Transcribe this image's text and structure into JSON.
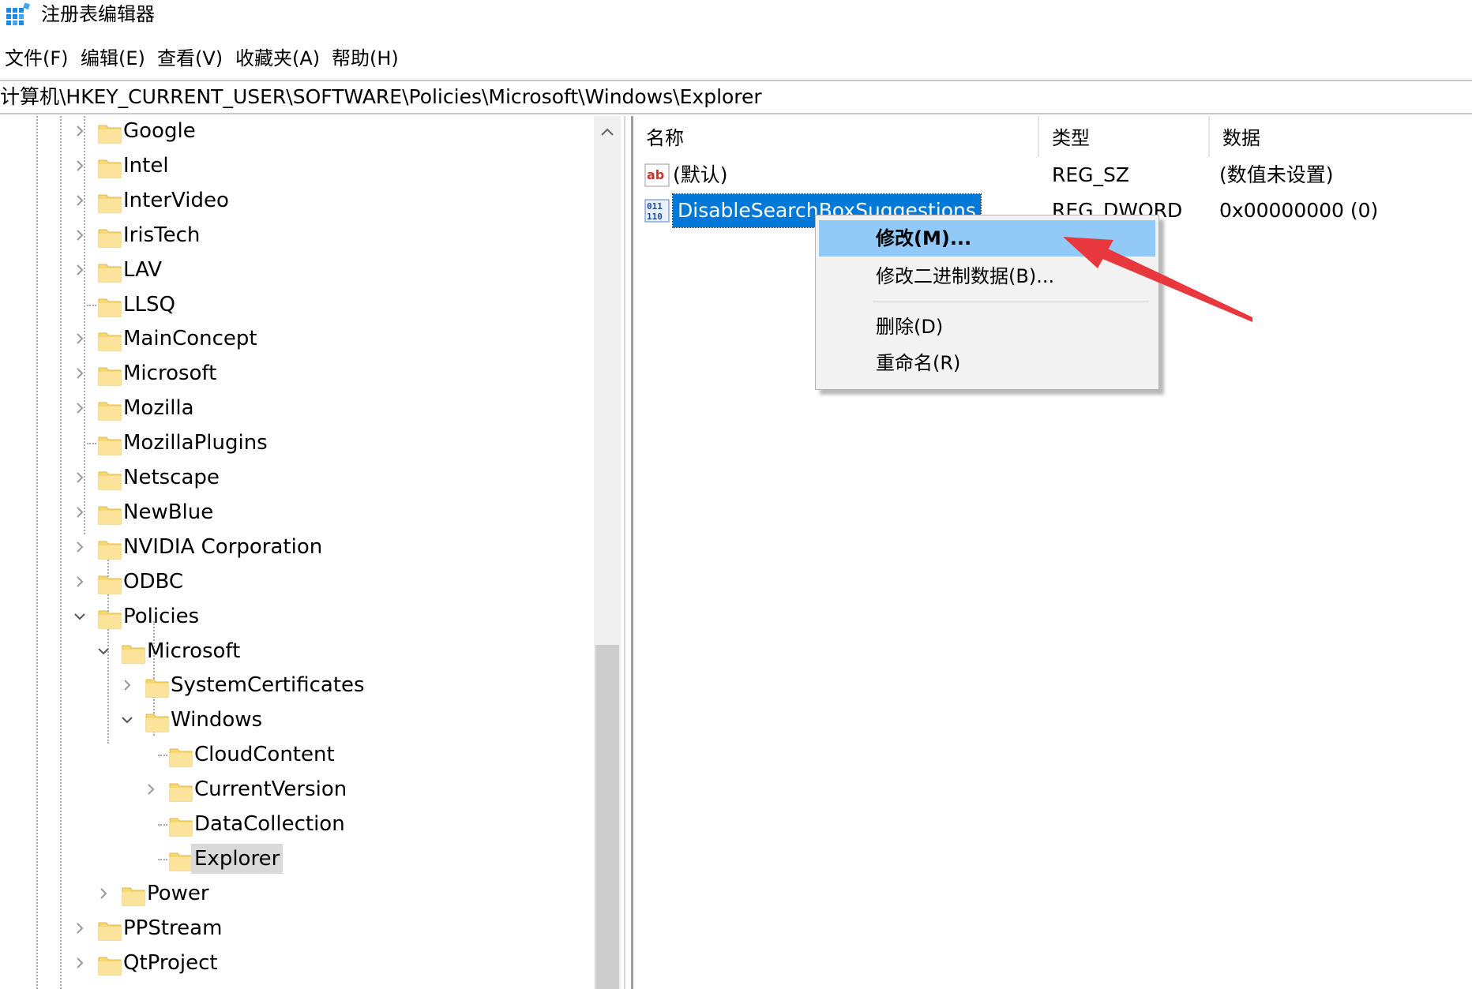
{
  "window": {
    "title": "注册表编辑器"
  },
  "menu": [
    {
      "label": "文件(F)"
    },
    {
      "label": "编辑(E)"
    },
    {
      "label": "查看(V)"
    },
    {
      "label": "收藏夹(A)"
    },
    {
      "label": "帮助(H)"
    }
  ],
  "address": {
    "path": "计算机\\HKEY_CURRENT_USER\\SOFTWARE\\Policies\\Microsoft\\Windows\\Explorer"
  },
  "tree": {
    "items": [
      {
        "label": "Google",
        "expander": "collapsed"
      },
      {
        "label": "Intel",
        "expander": "collapsed"
      },
      {
        "label": "InterVideo",
        "expander": "collapsed"
      },
      {
        "label": "IrisTech",
        "expander": "collapsed"
      },
      {
        "label": "LAV",
        "expander": "collapsed"
      },
      {
        "label": "LLSQ",
        "expander": "none"
      },
      {
        "label": "MainConcept",
        "expander": "collapsed"
      },
      {
        "label": "Microsoft",
        "expander": "collapsed"
      },
      {
        "label": "Mozilla",
        "expander": "collapsed"
      },
      {
        "label": "MozillaPlugins",
        "expander": "none"
      },
      {
        "label": "Netscape",
        "expander": "collapsed"
      },
      {
        "label": "NewBlue",
        "expander": "collapsed"
      },
      {
        "label": "NVIDIA Corporation",
        "expander": "collapsed"
      },
      {
        "label": "ODBC",
        "expander": "collapsed"
      },
      {
        "label": "Policies",
        "expander": "expanded"
      },
      {
        "label": "Microsoft",
        "expander": "expanded"
      },
      {
        "label": "SystemCertificates",
        "expander": "collapsed"
      },
      {
        "label": "Windows",
        "expander": "expanded"
      },
      {
        "label": "CloudContent",
        "expander": "none"
      },
      {
        "label": "CurrentVersion",
        "expander": "collapsed"
      },
      {
        "label": "DataCollection",
        "expander": "none"
      },
      {
        "label": "Explorer",
        "expander": "none",
        "selected": true
      },
      {
        "label": "Power",
        "expander": "collapsed"
      },
      {
        "label": "PPStream",
        "expander": "collapsed"
      },
      {
        "label": "QtProject",
        "expander": "collapsed"
      }
    ]
  },
  "list": {
    "columns": {
      "name": "名称",
      "type": "类型",
      "data": "数据"
    },
    "rows": [
      {
        "name": "(默认)",
        "type": "REG_SZ",
        "data": "(数值未设置)",
        "icon": "string-value-icon"
      },
      {
        "name": "DisableSearchBoxSuggestions",
        "type": "REG_DWORD",
        "data": "0x00000000 (0)",
        "icon": "binary-value-icon",
        "selected": true
      }
    ]
  },
  "context_menu": {
    "items": [
      {
        "label": "修改(M)...",
        "highlighted": true
      },
      {
        "label": "修改二进制数据(B)..."
      },
      {
        "label": "删除(D)"
      },
      {
        "label": "重命名(R)"
      }
    ]
  },
  "colors": {
    "selection": "#0078d7",
    "menu_highlight": "#91c9f7",
    "folder": "#f7d774",
    "annotation_arrow": "#e8383d"
  }
}
